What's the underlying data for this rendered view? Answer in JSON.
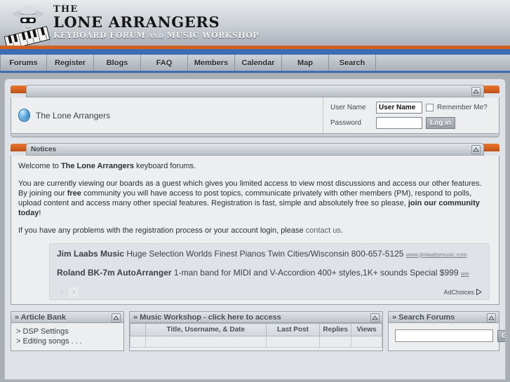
{
  "site": {
    "logo_the": "THE",
    "logo_name": "LONE ARRANGERS",
    "logo_sub_1": "KEYBOARD FORUM",
    "logo_sub_and": "AND",
    "logo_sub_2": "MUSIC WORKSHOP"
  },
  "nav": {
    "items": [
      {
        "label": "Forums"
      },
      {
        "label": "Register"
      },
      {
        "label": "Blogs"
      },
      {
        "label": "FAQ"
      },
      {
        "label": "Members"
      },
      {
        "label": "Calendar"
      },
      {
        "label": "Map"
      },
      {
        "label": "Search"
      }
    ]
  },
  "login": {
    "forum_title": "The Lone Arrangers",
    "username_label": "User Name",
    "username_value": "User Name",
    "username_placeholder": "User Name",
    "password_label": "Password",
    "password_value": "",
    "remember_label": "Remember Me?",
    "login_button": "Log in"
  },
  "notices": {
    "title": "Notices",
    "p1_pre": "Welcome to ",
    "p1_bold": "The Lone Arrangers",
    "p1_post": " keyboard forums.",
    "p2_a": "You are currently viewing our boards as a guest which gives you limited access to view most discussions and access our other features. By joining our ",
    "p2_b": "free",
    "p2_c": " community you will have access to post topics, communicate privately with other members (PM), respond to polls, upload content and access many other special features. Registration is fast, simple and absolutely free so please, ",
    "p2_d": "join our community today",
    "p2_e": "!",
    "p3_a": "If you have any problems with the registration process or your account login, please ",
    "p3_link": "contact us",
    "p3_b": "."
  },
  "ads": {
    "ad1_bold": "Jim Laabs Music",
    "ad1_text": " Huge Selection Worlds Finest Pianos Twin Cities/Wisconsin 800-657-5125 ",
    "ad1_url": "www.jimlaabsmusic.com",
    "ad2_bold": "Roland BK-7m AutoArranger",
    "ad2_text": " 1-man band for MIDI and V-Accordion 400+ styles,1K+ sounds Special $999 ",
    "ad2_url": "ww",
    "prev_arrow": "‹",
    "next_arrow": "›",
    "adchoices": "AdChoices"
  },
  "article_bank": {
    "title": "» Article Bank",
    "items": [
      "> DSP Settings",
      "> Editing songs . . ."
    ]
  },
  "music_workshop": {
    "title": "» Music Workshop - click here to access",
    "columns": [
      "",
      "Title, Username, & Date",
      "Last Post",
      "Replies",
      "Views"
    ],
    "rows": [
      [
        "",
        "",
        "",
        "",
        ""
      ]
    ]
  },
  "search_forums": {
    "title": "» Search Forums",
    "input_value": "",
    "go_button": "Go"
  }
}
